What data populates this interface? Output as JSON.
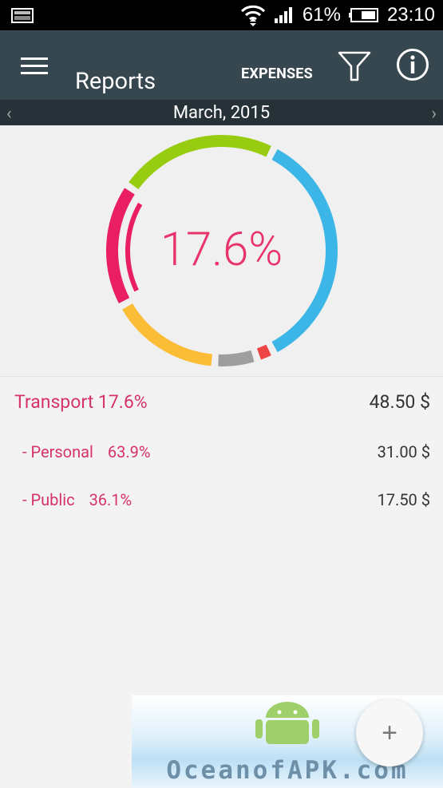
{
  "status_bar": {
    "battery": "61%",
    "time": "23:10"
  },
  "app_bar": {
    "title": "Reports",
    "mode_label": "EXPENSES"
  },
  "month_nav": {
    "month": "March, 2015",
    "prev_label": "‹",
    "next_label": "›"
  },
  "chart": {
    "center_label": "17.6%"
  },
  "chart_data": {
    "type": "pie",
    "style": "donut",
    "slices": [
      {
        "value": 35.0,
        "color": "#3bb6e6"
      },
      {
        "value": 2.5,
        "color": "#ef4444"
      },
      {
        "value": 6.0,
        "color": "#9e9e9e"
      },
      {
        "value": 16.0,
        "color": "#fbbc36"
      },
      {
        "value": 17.6,
        "color": "#e91e63"
      },
      {
        "value": 22.9,
        "color": "#98cc10"
      }
    ],
    "selected_inner": {
      "value": 17.6,
      "color": "#e91e63"
    }
  },
  "categories": {
    "main": {
      "name": "Transport 17.6%",
      "amount": "48.50 $"
    },
    "subs": [
      {
        "name": "- Personal",
        "pct": "63.9%",
        "amount": "31.00 $"
      },
      {
        "name": "- Public",
        "pct": "36.1%",
        "amount": "17.50 $"
      }
    ]
  },
  "watermark": {
    "text": "OceanofAPK.com"
  },
  "fab": {
    "label": "+"
  }
}
